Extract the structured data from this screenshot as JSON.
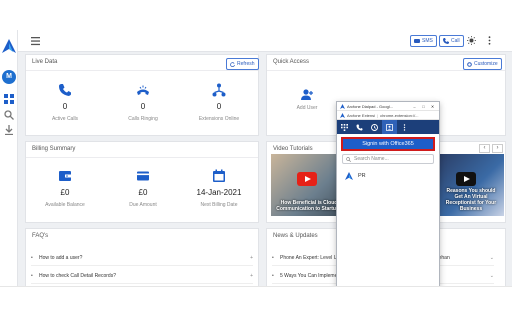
{
  "topbar": {
    "sms_label": "SMS",
    "call_label": "Call"
  },
  "rail": {
    "avatar_initial": "M"
  },
  "live_data": {
    "title": "Live Data",
    "refresh_label": "Refresh",
    "stats": [
      {
        "icon": "phone-icon",
        "value": "0",
        "label": "Active Calls"
      },
      {
        "icon": "ringing-phone-icon",
        "value": "0",
        "label": "Calls Ringing"
      },
      {
        "icon": "network-icon",
        "value": "0",
        "label": "Extensions Online"
      }
    ]
  },
  "quick_access": {
    "title": "Quick Access",
    "customize_label": "Customize",
    "add_user_label": "Add User"
  },
  "billing": {
    "title": "Billing Summary",
    "items": [
      {
        "icon": "wallet-icon",
        "value": "£0",
        "label": "Available Balance"
      },
      {
        "icon": "credit-card-icon",
        "value": "£0",
        "label": "Due Amount"
      },
      {
        "icon": "calendar-icon",
        "value": "14-Jan-2021",
        "label": "Next Billing Date"
      }
    ]
  },
  "videos": {
    "title": "Video Tutorials",
    "items": [
      {
        "caption": "How Beneficial is Cloud Communication to Startups"
      },
      {
        "caption": "Reasons You should Get An Virtual Receptionist for Your Business"
      }
    ]
  },
  "faqs": {
    "title": "FAQ's",
    "items": [
      "How to add a user?",
      "How to check Call Detail Records?"
    ]
  },
  "news": {
    "title": "News & Updates",
    "items": [
      "Phone An Expert: Level Up Your Customer Service Game With Jeff Sheehan",
      "5 Ways You Can Implement Cloud-Enabled WFH Post COVID-19"
    ]
  },
  "popup": {
    "window_title": "Arcfone Dialpad - Googl...",
    "address_site": "Arcfone Extensi",
    "address_url": "chrome-extension://...",
    "signin_label": "Signin with Office365",
    "search_placeholder": "Search Name...",
    "user_name": "PR"
  },
  "colors": {
    "accent": "#1d5ec9",
    "popup_toolbar": "#1c3f7a",
    "highlight": "#d01b1b",
    "page_bg": "#eef0f3"
  }
}
